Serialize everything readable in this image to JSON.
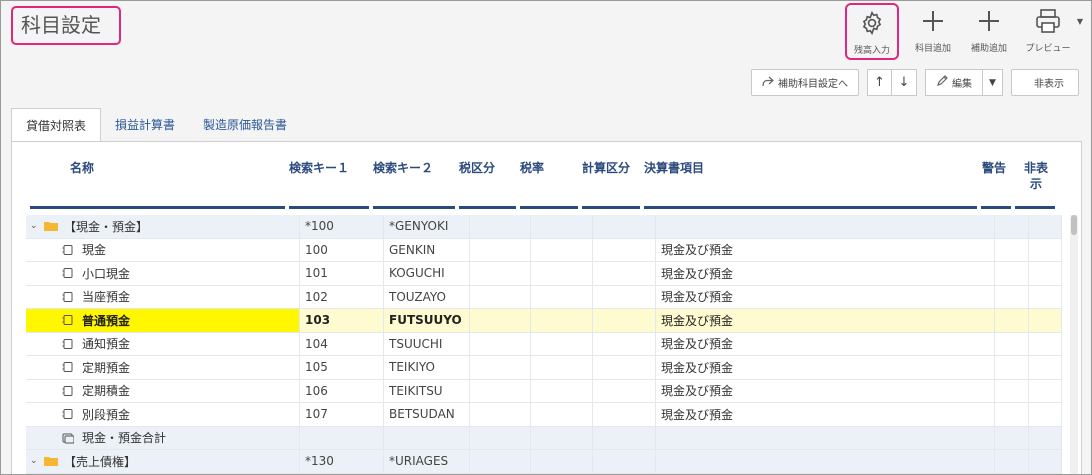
{
  "page": {
    "title": "科目設定"
  },
  "toolbar": {
    "balance_label": "残高入力",
    "add_account_label": "科目追加",
    "add_sub_label": "補助追加",
    "preview_label": "プレビュー"
  },
  "actions": {
    "sub_setting_label": "補助科目設定へ",
    "up_arrow": "↑",
    "down_arrow": "↓",
    "edit_label": "編集",
    "hide_label": "非表示"
  },
  "tabs": [
    {
      "label": "貸借対照表"
    },
    {
      "label": "損益計算書"
    },
    {
      "label": "製造原価報告書"
    }
  ],
  "columns": {
    "name": "名称",
    "key1": "検索キー１",
    "key2": "検索キー２",
    "tax": "税区分",
    "rate": "税率",
    "calc": "計算区分",
    "kessan": "決算書項目",
    "warn": "警告",
    "hide_top": "非表",
    "hide_bottom": "示"
  },
  "rows": [
    {
      "name": "【現金・預金】",
      "k1": "*100",
      "k2": "*GENYOKI",
      "kessan": ""
    },
    {
      "name": "現金",
      "k1": "100",
      "k2": "GENKIN",
      "kessan": "現金及び預金"
    },
    {
      "name": "小口現金",
      "k1": "101",
      "k2": "KOGUCHI",
      "kessan": "現金及び預金"
    },
    {
      "name": "当座預金",
      "k1": "102",
      "k2": "TOUZAYO",
      "kessan": "現金及び預金"
    },
    {
      "name": "普通預金",
      "k1": "103",
      "k2": "FUTSUUYO",
      "kessan": "現金及び預金"
    },
    {
      "name": "通知預金",
      "k1": "104",
      "k2": "TSUUCHI",
      "kessan": "現金及び預金"
    },
    {
      "name": "定期預金",
      "k1": "105",
      "k2": "TEIKIYO",
      "kessan": "現金及び預金"
    },
    {
      "name": "定期積金",
      "k1": "106",
      "k2": "TEIKITSU",
      "kessan": "現金及び預金"
    },
    {
      "name": "別段預金",
      "k1": "107",
      "k2": "BETSUDAN",
      "kessan": "現金及び預金"
    },
    {
      "name": "現金・預金合計",
      "k1": "",
      "k2": "",
      "kessan": ""
    },
    {
      "name": "【売上債権】",
      "k1": "*130",
      "k2": "*URIAGES",
      "kessan": ""
    }
  ],
  "colors": {
    "accent": "#e0267d",
    "header": "#2b4a7d",
    "selected": "#fff700",
    "folder": "#f5b731"
  }
}
